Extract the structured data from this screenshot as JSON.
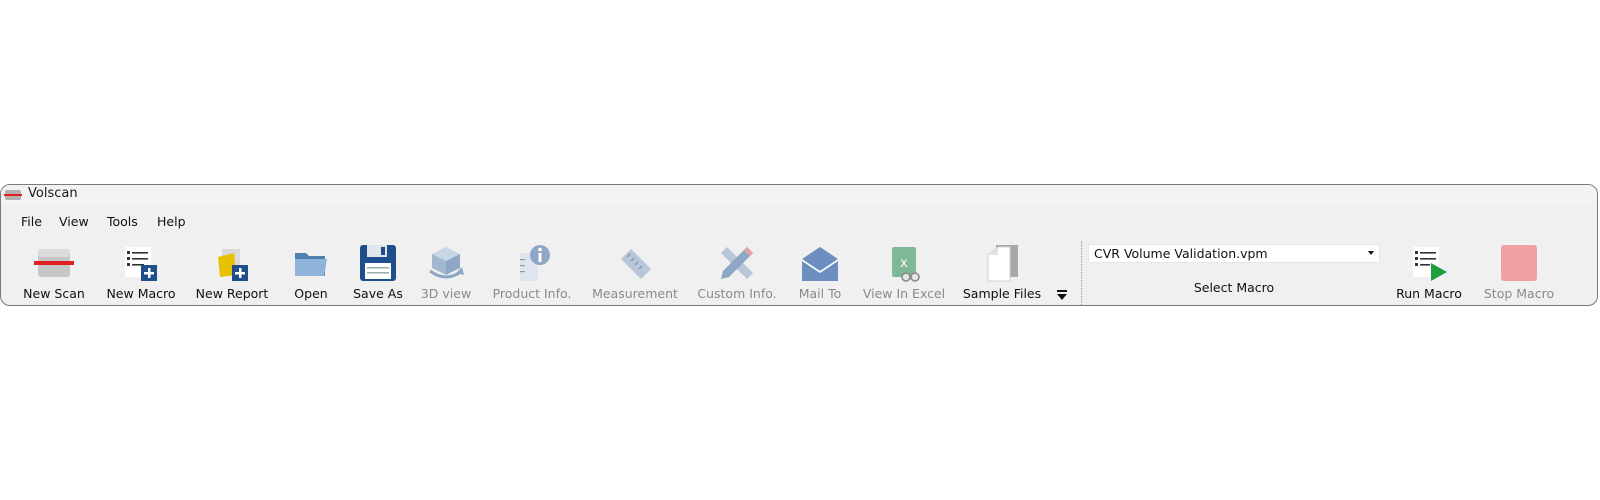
{
  "window": {
    "title": "Volscan"
  },
  "menu": [
    "File",
    "View",
    "Tools",
    "Help"
  ],
  "toolbar": {
    "buttons": [
      {
        "label": "New Scan",
        "icon": "scanner-icon",
        "enabled": true
      },
      {
        "label": "New Macro",
        "icon": "new-macro-icon",
        "enabled": true
      },
      {
        "label": "New Report",
        "icon": "new-report-icon",
        "enabled": true
      },
      {
        "label": "Open",
        "icon": "folder-open-icon",
        "enabled": true
      },
      {
        "label": "Save As",
        "icon": "floppy-disk-icon",
        "enabled": true
      },
      {
        "label": "3D view",
        "icon": "cube-rotate-icon",
        "enabled": false
      },
      {
        "label": "Product Info.",
        "icon": "product-info-icon",
        "enabled": false
      },
      {
        "label": "Measurement",
        "icon": "ruler-icon",
        "enabled": false
      },
      {
        "label": "Custom Info.",
        "icon": "pencil-ruler-icon",
        "enabled": false
      },
      {
        "label": "Mail To",
        "icon": "envelope-icon",
        "enabled": false
      },
      {
        "label": "View In Excel",
        "icon": "excel-icon",
        "enabled": false
      },
      {
        "label": "Sample Files",
        "icon": "files-icon",
        "enabled": true
      }
    ],
    "macro_select": {
      "value": "CVR Volume Validation.vpm",
      "label": "Select Macro"
    },
    "run_macro": {
      "label": "Run Macro",
      "icon": "run-macro-icon",
      "enabled": true
    },
    "stop_macro": {
      "label": "Stop Macro",
      "icon": "stop-icon",
      "enabled": false
    }
  },
  "colors": {
    "window_bg": "#f0f0f0",
    "scan_red": "#e02020",
    "brand_blue": "#1f4e8c",
    "run_green": "#1f9e3a",
    "stop_red": "#f0a0a0"
  }
}
